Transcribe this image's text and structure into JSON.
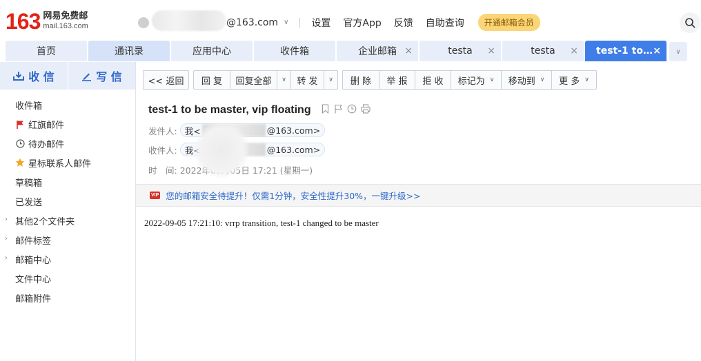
{
  "brand": {
    "logo_number": "163",
    "logo_cn": "网易免费邮",
    "logo_en": "mail.163.com"
  },
  "header": {
    "account_suffix": "@163.com",
    "links": [
      "设置",
      "官方App",
      "反馈",
      "自助查询"
    ],
    "vip_button": "开通邮箱会员"
  },
  "tabs": [
    {
      "label": "首页",
      "closable": false
    },
    {
      "label": "通讯录",
      "closable": false
    },
    {
      "label": "应用中心",
      "closable": false
    },
    {
      "label": "收件箱",
      "closable": false
    },
    {
      "label": "企业邮箱",
      "closable": true
    },
    {
      "label": "testa",
      "closable": true
    },
    {
      "label": "testa",
      "closable": true
    },
    {
      "label": "test-1 to be master, vip floating",
      "closable": true,
      "active": true
    }
  ],
  "sidebar": {
    "receive_label": "收 信",
    "write_label": "写 信",
    "items": [
      {
        "label": "收件箱",
        "icon": "none"
      },
      {
        "label": "红旗邮件",
        "icon": "red-flag-icon"
      },
      {
        "label": "待办邮件",
        "icon": "clock-icon"
      },
      {
        "label": "星标联系人邮件",
        "icon": "star-icon"
      },
      {
        "label": "草稿箱",
        "icon": "none"
      },
      {
        "label": "已发送",
        "icon": "none"
      },
      {
        "label": "其他2个文件夹",
        "icon": "none",
        "expandable": true
      },
      {
        "label": "邮件标签",
        "icon": "none",
        "expandable": true
      },
      {
        "label": "邮箱中心",
        "icon": "none",
        "expandable": true
      },
      {
        "label": "文件中心",
        "icon": "none"
      },
      {
        "label": "邮箱附件",
        "icon": "none"
      }
    ]
  },
  "toolbar": {
    "back": "<< 返回",
    "reply": "回 复",
    "reply_all": "回复全部",
    "forward": "转 发",
    "delete": "删 除",
    "report": "举 报",
    "reject": "拒 收",
    "mark_as": "标记为",
    "move_to": "移动到",
    "more": "更 多"
  },
  "message": {
    "subject": "test-1 to be master, vip floating",
    "from_label": "发件人:",
    "from_prefix": "我<",
    "from_suffix": "@163.com>",
    "to_label": "收件人:",
    "to_prefix": "我<",
    "to_suffix": "@163.com>",
    "time_label": "时　间:",
    "time_value": "2022年09月05日 17:21 (星期一)",
    "notice": "您的邮箱安全待提升！仅需1分钟，安全性提升30%，一键升级>>",
    "notice_tag": "VIP",
    "body": "2022-09-05 17:21:10: vrrp transition, test-1 changed to be master"
  },
  "colors": {
    "accent": "#3f7ee8",
    "brand_red": "#e2231a",
    "link_blue": "#2d67c9",
    "vip_yellow": "#fbd679"
  }
}
